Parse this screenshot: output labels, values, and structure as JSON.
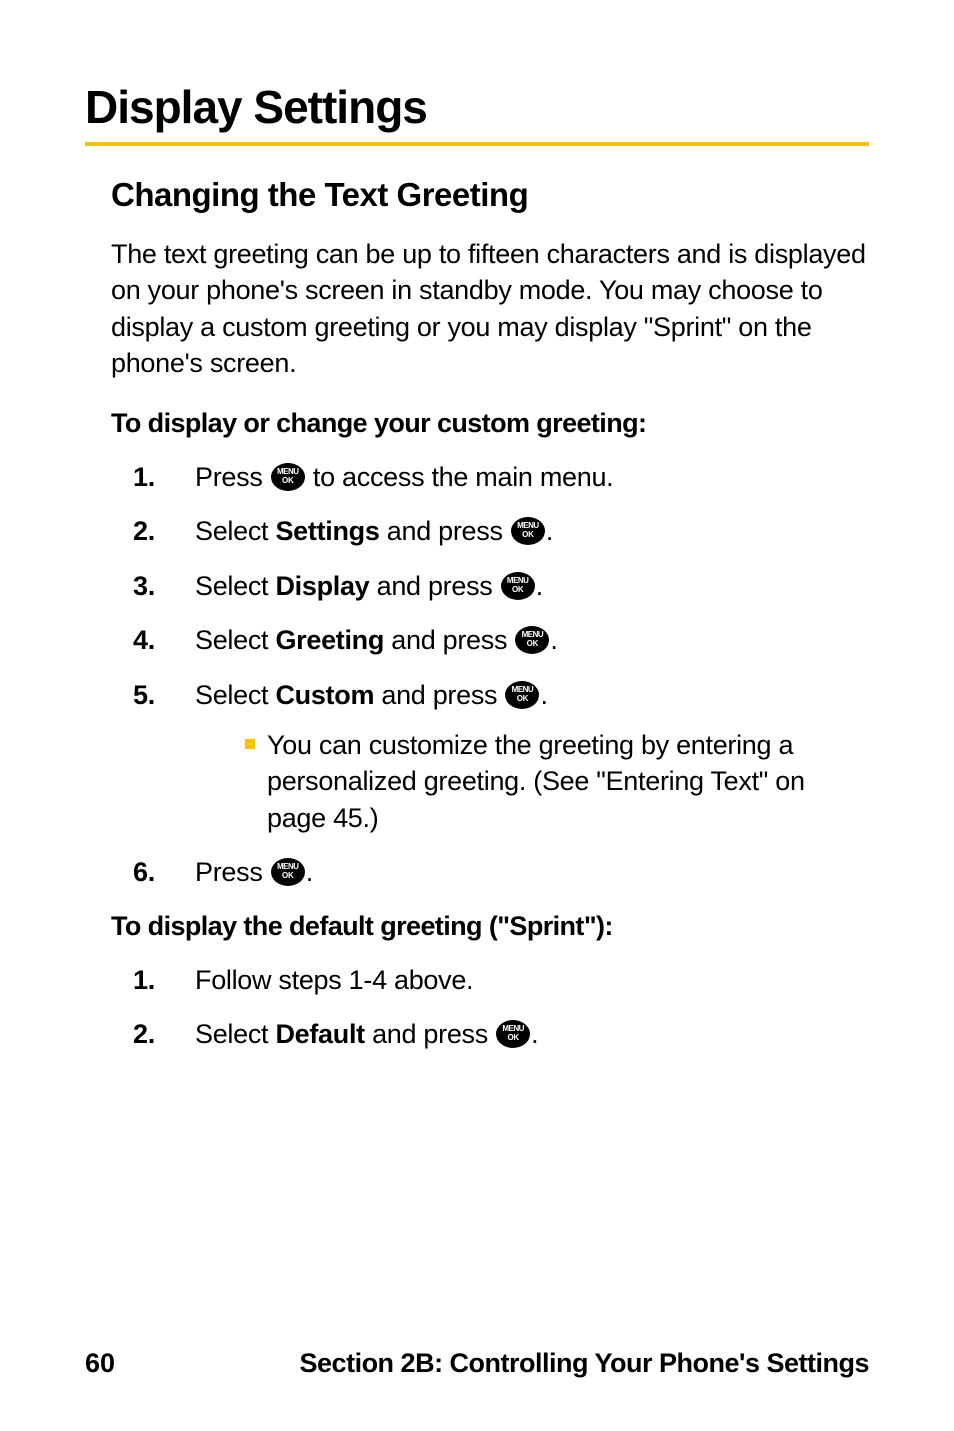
{
  "icon": {
    "label_top": "MENU",
    "label_bottom": "OK"
  },
  "title": "Display Settings",
  "subheading": "Changing the Text Greeting",
  "intro": "The text greeting can be up to fifteen characters and is displayed on your phone's screen in standby mode. You may choose to display a custom greeting or you may display \"Sprint\" on the phone's screen.",
  "instruction1_title": "To display or change your custom greeting:",
  "steps1": {
    "s1": {
      "num": "1.",
      "pre": "Press ",
      "post": " to access the main menu."
    },
    "s2": {
      "num": "2.",
      "pre": "Select ",
      "bold": "Settings",
      "mid": " and press ",
      "post": "."
    },
    "s3": {
      "num": "3.",
      "pre": "Select ",
      "bold": "Display",
      "mid": " and press ",
      "post": "."
    },
    "s4": {
      "num": "4.",
      "pre": "Select ",
      "bold": "Greeting",
      "mid": " and press ",
      "post": "."
    },
    "s5": {
      "num": "5.",
      "pre": "Select ",
      "bold": "Custom",
      "mid": " and press ",
      "post": ".",
      "sub": "You can customize the greeting by entering a personalized greeting. (See \"Entering Text\" on page 45.)"
    },
    "s6": {
      "num": "6.",
      "pre": "Press ",
      "post": "."
    }
  },
  "instruction2_title": "To display the default greeting (\"Sprint\"):",
  "steps2": {
    "s1": {
      "num": "1.",
      "text": "Follow steps 1-4 above."
    },
    "s2": {
      "num": "2.",
      "pre": "Select ",
      "bold": "Default",
      "mid": " and press ",
      "post": "."
    }
  },
  "footer": {
    "page": "60",
    "section": "Section 2B: Controlling Your Phone's Settings"
  }
}
